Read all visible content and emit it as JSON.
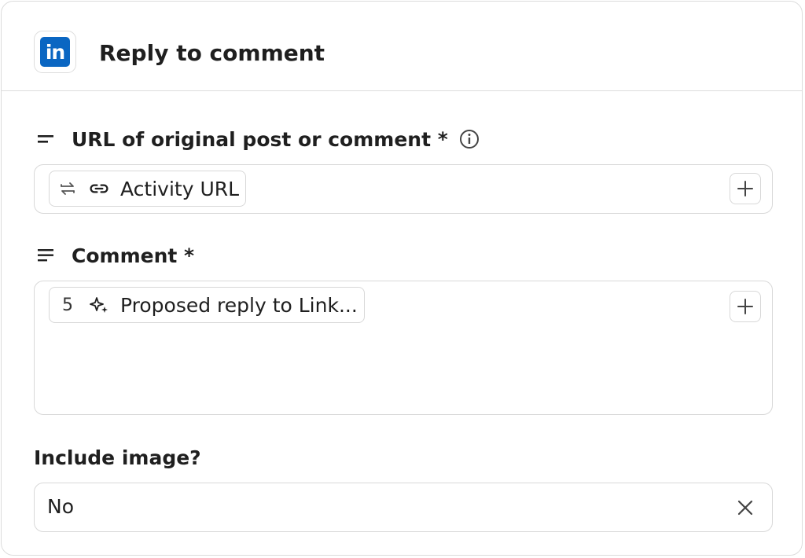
{
  "header": {
    "app_icon": "linkedin-logo",
    "app_icon_text": "in",
    "title": "Reply to comment"
  },
  "fields": {
    "url": {
      "label": "URL of original post or comment *",
      "label_icon": "short-text-icon",
      "info_icon": "info-icon",
      "token": {
        "icon1": "repeat-icon",
        "icon2": "link-icon",
        "text": "Activity URL"
      },
      "add_icon": "plus-icon"
    },
    "comment": {
      "label": "Comment *",
      "label_icon": "long-text-icon",
      "token": {
        "step": "5",
        "icon": "sparkles-icon",
        "text": "Proposed reply to Link..."
      },
      "add_icon": "plus-icon"
    },
    "include_image": {
      "label": "Include image?",
      "value": "No",
      "clear_icon": "close-icon"
    }
  },
  "colors": {
    "brand": "#0a66c2",
    "border": "#d8d8d8",
    "text": "#1f1f1f"
  }
}
